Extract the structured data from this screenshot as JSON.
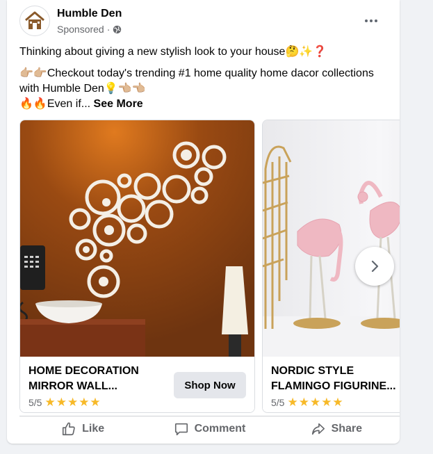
{
  "post": {
    "page_name": "Humble Den",
    "sponsored": "Sponsored",
    "dot": "·",
    "text_line1": "Thinking about giving a new stylish look to your house🤔✨❓",
    "text_line2": "👉🏼👉🏼Checkout today's trending #1 home quality home dacor collections with Humble Den💡👈🏼👈🏼",
    "text_line3": "🔥🔥Even if...",
    "see_more": "See More"
  },
  "carousel": {
    "items": [
      {
        "title": "HOME DECORATION MIRROR WALL...",
        "rating": "5/5",
        "stars": "★★★★★",
        "cta": "Shop Now"
      },
      {
        "title": "NORDIC STYLE FLAMINGO FIGURINE...",
        "rating": "5/5",
        "stars": "★★★★★"
      }
    ]
  },
  "actions": {
    "like": "Like",
    "comment": "Comment",
    "share": "Share"
  },
  "colors": {
    "secondary_text": "#65676b",
    "star": "#f7b928",
    "button_bg": "#e4e6eb"
  }
}
